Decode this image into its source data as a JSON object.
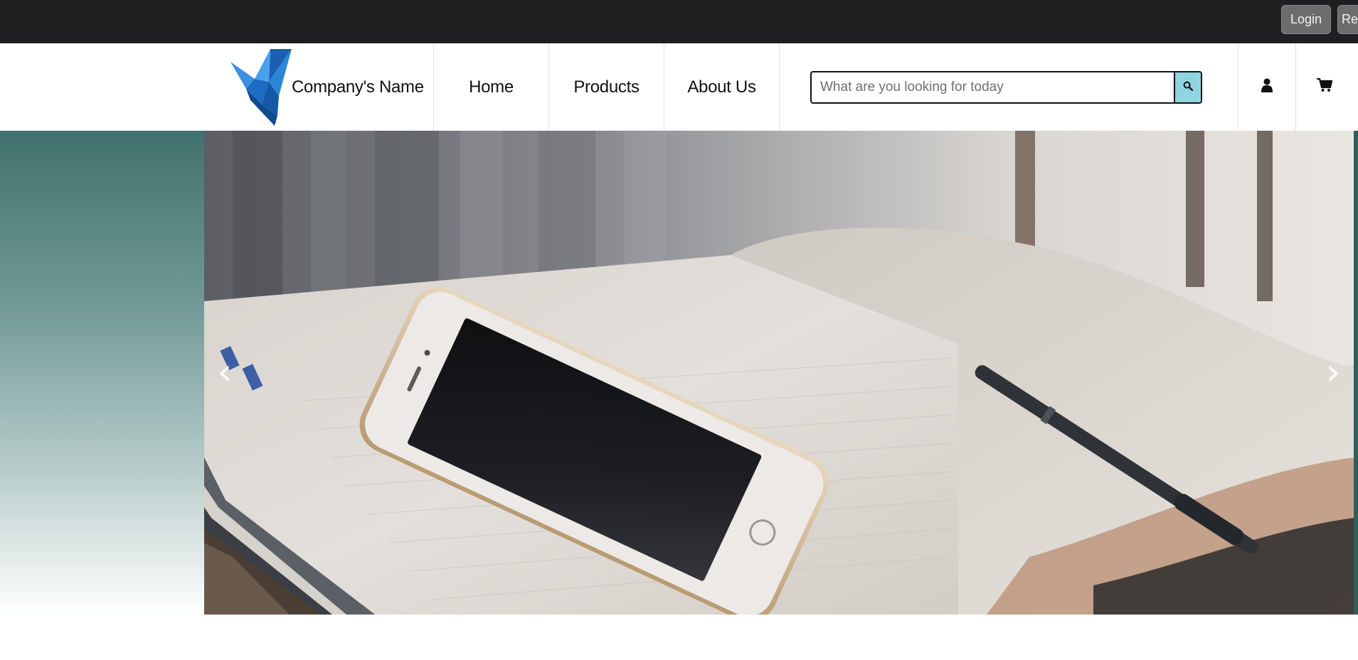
{
  "topbar": {
    "login_label": "Login",
    "register_label": "Reg"
  },
  "header": {
    "brand_name": "Company's Name",
    "logo_icon": "origami-bird-logo-icon",
    "nav": [
      {
        "label": "Home"
      },
      {
        "label": "Products"
      },
      {
        "label": "About Us"
      }
    ],
    "search": {
      "placeholder": "What are you looking for today",
      "value": "",
      "button_icon": "search-icon"
    },
    "account_icon": "user-icon",
    "cart_icon": "shopping-cart-icon"
  },
  "hero": {
    "image_subject": "smartphone and pen on open notebook",
    "prev_arrow": "‹",
    "next_arrow": "›"
  },
  "colors": {
    "topbar_bg": "#1f1f21",
    "button_bg": "#6c6c6c",
    "search_button_bg": "#8fd4e0",
    "hero_gradient_top": "#41716e",
    "logo_blue": "#1d6fc4"
  }
}
